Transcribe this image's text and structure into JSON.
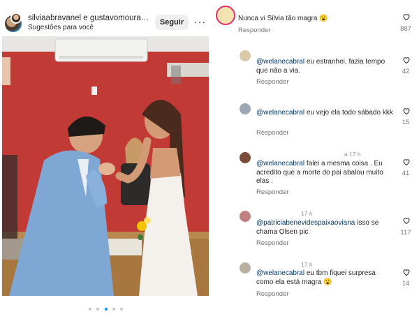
{
  "post": {
    "username": "silviaabravanel e gustavomouraer...",
    "subtitle": "Sugestões para você",
    "follow_label": "Seguir",
    "more_icon": "···",
    "carousel_dots": 5,
    "carousel_active_index": 2
  },
  "comments": [
    {
      "username": "",
      "mention": "",
      "text": "Nunca vi Silvia tão magra 😮",
      "reply_label": "Responder",
      "likes": "887"
    },
    {
      "username": "",
      "mention": "@welanecabral",
      "text": " eu estranhei, fazia tempo que não a via.",
      "reply_label": "Responder",
      "likes": "42"
    },
    {
      "username": "",
      "mention": "@welanecabral",
      "text": " eu vejo ela todo sábado kkk",
      "reply_label": "Responder",
      "likes": "15"
    },
    {
      "username": "a 17 h",
      "mention": "@welanecabral",
      "text": " falei a mesma coisa . Eu acredito que a morte do pai abalou muito elas .",
      "reply_label": "Responder",
      "likes": "41"
    },
    {
      "username": "17 h",
      "mention": "@patriciabenevidespaixaoviana",
      "text": " isso se chama Olsen pic",
      "reply_label": "Responder",
      "likes": "117"
    },
    {
      "username": "17 h",
      "mention": "@welanecabral",
      "text": " eu tbm fiquei surpresa como ela está magra 😮",
      "reply_label": "Responder",
      "likes": "14"
    }
  ],
  "colors": {
    "mention": "#00376b",
    "secondary_text": "#737373",
    "wall": "#c23a36",
    "active_dot": "#0095f6"
  }
}
